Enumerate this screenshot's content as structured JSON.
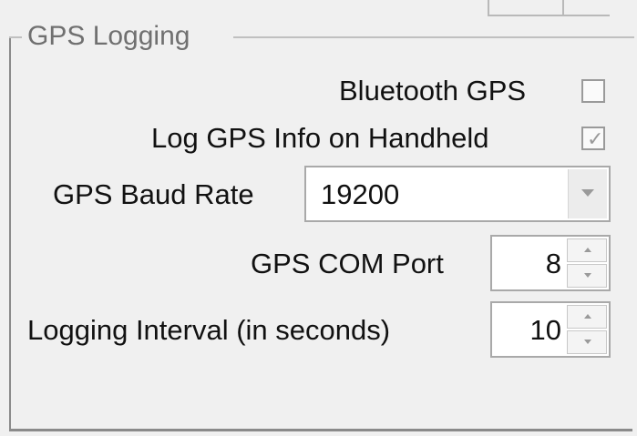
{
  "group": {
    "title": "GPS Logging"
  },
  "bluetooth_gps": {
    "label": "Bluetooth GPS",
    "checked": false
  },
  "log_gps_info": {
    "label": "Log GPS Info on Handheld",
    "checked": true
  },
  "baud_rate": {
    "label": "GPS Baud Rate",
    "value": "19200"
  },
  "com_port": {
    "label": "GPS COM Port",
    "value": "8"
  },
  "logging_interval": {
    "label": "Logging Interval (in seconds)",
    "value": "10"
  },
  "icons": {
    "dropdown": "chevron-down-icon",
    "spin_up": "spin-up-icon",
    "spin_down": "spin-down-icon",
    "check": "checkmark-icon"
  }
}
